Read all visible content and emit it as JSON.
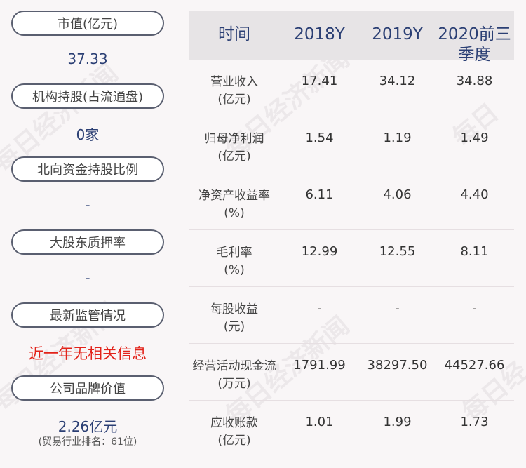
{
  "left_panel": {
    "items": [
      {
        "label": "市值(亿元)",
        "value": "37.33"
      },
      {
        "label": "机构持股(占流通盘)",
        "value": "0家"
      },
      {
        "label": "北向资金持股比例",
        "value": "-"
      },
      {
        "label": "大股东质押率",
        "value": "-"
      },
      {
        "label": "最新监管情况",
        "value": "近一年无相关信息"
      },
      {
        "label": "公司品牌价值",
        "value": "2.26亿元",
        "sub": "(贸易行业排名：61位)"
      }
    ]
  },
  "table": {
    "headers": [
      "时间",
      "2018Y",
      "2019Y",
      "2020前三季度"
    ],
    "rows": [
      {
        "label1": "营业收入",
        "label2": "(亿元)",
        "v": [
          "17.41",
          "34.12",
          "34.88"
        ]
      },
      {
        "label1": "归母净利润",
        "label2": "(亿元)",
        "v": [
          "1.54",
          "1.19",
          "1.49"
        ]
      },
      {
        "label1": "净资产收益率",
        "label2": "(%)",
        "v": [
          "6.11",
          "4.06",
          "4.40"
        ]
      },
      {
        "label1": "毛利率",
        "label2": "(%)",
        "v": [
          "12.99",
          "12.55",
          "8.11"
        ]
      },
      {
        "label1": "每股收益",
        "label2": "(元)",
        "v": [
          "-",
          "-",
          "-"
        ]
      },
      {
        "label1": "经营活动现金流",
        "label2": "(万元)",
        "v": [
          "1791.99",
          "38297.50",
          "44527.66"
        ]
      },
      {
        "label1": "应收账款",
        "label2": "(亿元)",
        "v": [
          "1.01",
          "1.99",
          "1.73"
        ]
      }
    ]
  },
  "watermark": "每日经济新闻",
  "colors": {
    "value_blue": "#2b3f74",
    "alert_red": "#e2231a",
    "header_bg": "#e7e4e6"
  }
}
